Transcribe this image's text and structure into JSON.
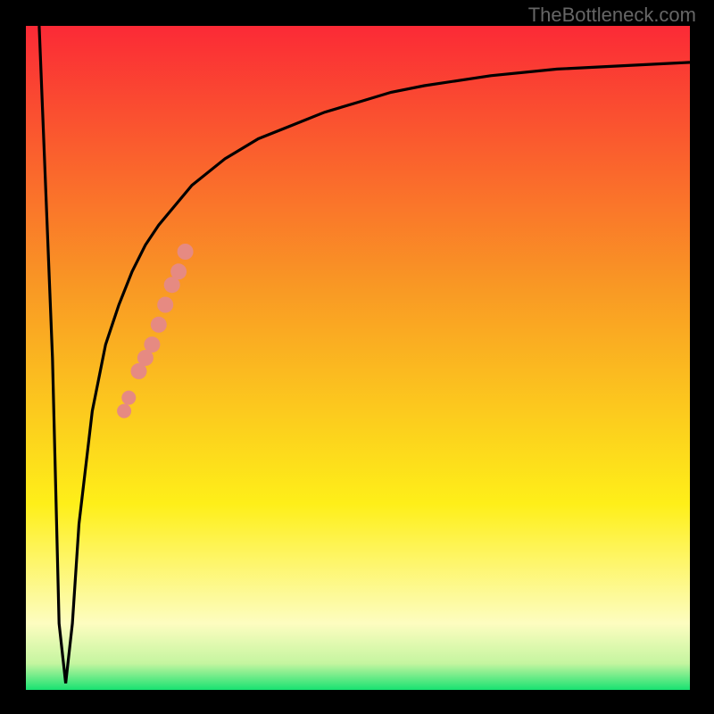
{
  "watermark": "TheBottleneck.com",
  "colors": {
    "frame_bg": "#000000",
    "gradient_top": "#fb2a36",
    "gradient_mid1": "#f99a24",
    "gradient_mid2": "#feef19",
    "gradient_bottom": "#18e271",
    "curve": "#000000",
    "markers": "#e68a82"
  },
  "chart_data": {
    "type": "line",
    "title": "",
    "xlabel": "",
    "ylabel": "",
    "xlim": [
      0,
      100
    ],
    "ylim": [
      0,
      100
    ],
    "series": [
      {
        "name": "curve",
        "x": [
          2,
          4,
          5,
          6,
          7,
          8,
          10,
          12,
          14,
          16,
          18,
          20,
          25,
          30,
          35,
          40,
          45,
          50,
          55,
          60,
          70,
          80,
          90,
          100
        ],
        "y": [
          100,
          50,
          10,
          1,
          10,
          25,
          42,
          52,
          58,
          63,
          67,
          70,
          76,
          80,
          83,
          85,
          87,
          88.5,
          90,
          91,
          92.5,
          93.5,
          94,
          94.5
        ]
      }
    ],
    "markers": {
      "name": "segment-a",
      "x": [
        17,
        18,
        19,
        20,
        21,
        22,
        23,
        24
      ],
      "y": [
        48,
        50,
        52,
        55,
        58,
        61,
        63,
        66
      ]
    },
    "markers2": {
      "name": "segment-b",
      "x": [
        14.8,
        15.5
      ],
      "y": [
        42,
        44
      ]
    },
    "gradient_bands": [
      {
        "y": 100,
        "color": "#fb2a36"
      },
      {
        "y": 60,
        "color": "#f99a24"
      },
      {
        "y": 25,
        "color": "#feef19"
      },
      {
        "y": 6,
        "color": "#f8fcb0"
      },
      {
        "y": 0,
        "color": "#18e271"
      }
    ]
  }
}
